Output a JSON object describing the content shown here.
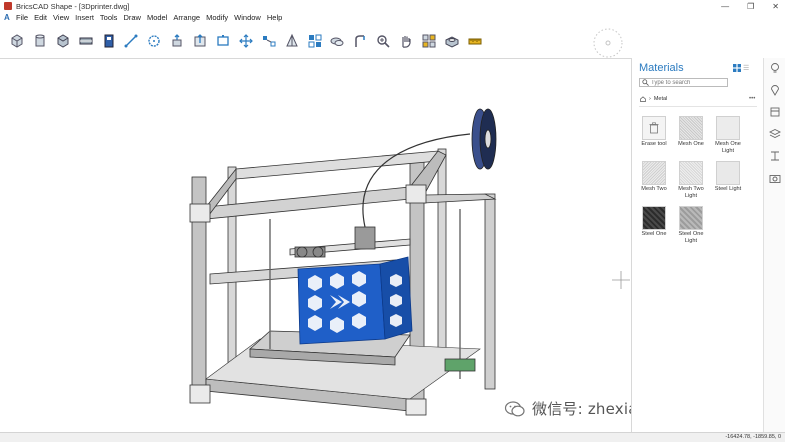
{
  "window": {
    "title": "BricsCAD Shape - [3Dprinter.dwg]",
    "controls": [
      "—",
      "❐",
      "✕"
    ]
  },
  "menu": [
    "File",
    "Edit",
    "View",
    "Insert",
    "Tools",
    "Draw",
    "Model",
    "Arrange",
    "Modify",
    "Window",
    "Help"
  ],
  "toolbar": {
    "icons": [
      "box-icon",
      "cylinder-icon",
      "sphere-icon",
      "slab-icon",
      "wall-icon",
      "line-icon",
      "circle-icon",
      "extrude-icon",
      "push-pull-icon",
      "rectangle-icon",
      "move-icon",
      "mirror-icon",
      "array-icon",
      "join-icon",
      "arc-icon",
      "zoom-icon",
      "pan-icon",
      "view-icon",
      "render-icon",
      "measure-icon"
    ]
  },
  "materials": {
    "title": "Materials",
    "search_placeholder": "Type to search",
    "breadcrumb": "Metal",
    "items": [
      {
        "label": "Erase tool",
        "swatch": "erase"
      },
      {
        "label": "Mesh One",
        "swatch": "mesh-light"
      },
      {
        "label": "Mesh One Light",
        "swatch": "plain-light"
      },
      {
        "label": "Mesh Two",
        "swatch": "mesh-light"
      },
      {
        "label": "Mesh Two Light",
        "swatch": "mesh-light"
      },
      {
        "label": "Steel Light",
        "swatch": "plain-light"
      },
      {
        "label": "Steel One",
        "swatch": "dark-diagonal"
      },
      {
        "label": "Steel One Light",
        "swatch": "light-diagonal"
      }
    ]
  },
  "side_strip": {
    "icons": [
      "bulb-icon",
      "marker-icon",
      "layers-stack-icon",
      "cube-stack-icon",
      "section-icon",
      "camera-icon"
    ]
  },
  "watermark": {
    "text": "微信号: zhexiangdonghua"
  },
  "status": {
    "coords": "-16424.78, -1859.85, 0"
  },
  "colors": {
    "accent": "#2b7bc0",
    "part_blue": "#1f5fc8",
    "frame_gray": "#8a8a8a"
  }
}
